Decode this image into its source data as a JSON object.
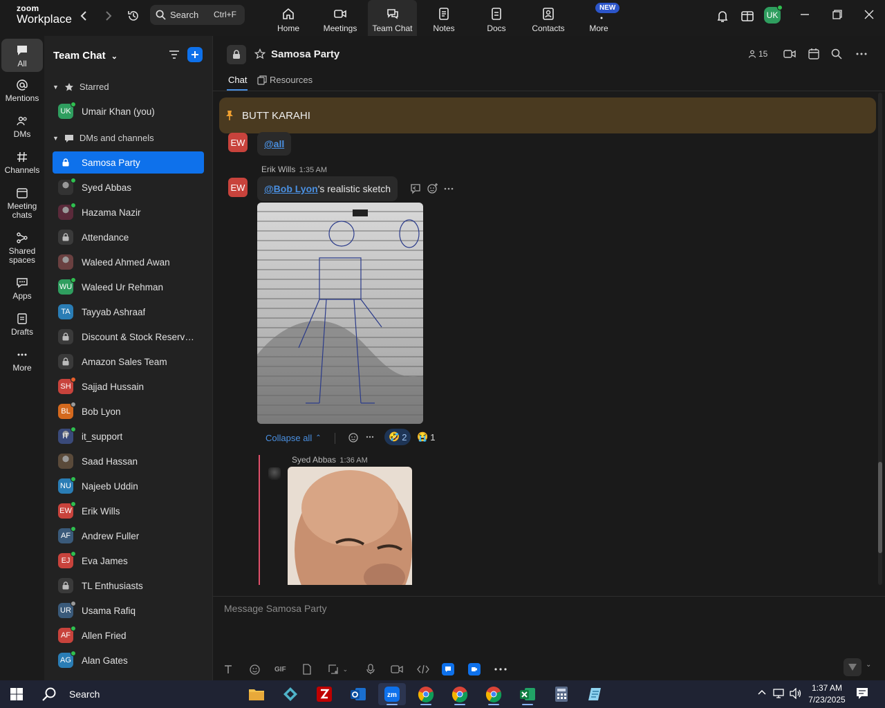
{
  "app": {
    "logo_top": "zoom",
    "logo_bottom": "Workplace"
  },
  "search": {
    "label": "Search",
    "shortcut": "Ctrl+F"
  },
  "top_tabs": [
    {
      "label": "Home",
      "icon": "home-icon"
    },
    {
      "label": "Meetings",
      "icon": "video-icon"
    },
    {
      "label": "Team Chat",
      "icon": "chat-icon",
      "active": true
    },
    {
      "label": "Notes",
      "icon": "notes-icon"
    },
    {
      "label": "Docs",
      "icon": "docs-icon"
    },
    {
      "label": "Contacts",
      "icon": "contacts-icon"
    },
    {
      "label": "More",
      "icon": "more-icon"
    }
  ],
  "new_badge": "NEW",
  "user_avatar": "UK",
  "rail": [
    {
      "label": "All",
      "icon": "chat-bubble-icon",
      "active": true
    },
    {
      "label": "Mentions",
      "icon": "at-icon"
    },
    {
      "label": "DMs",
      "icon": "people-icon"
    },
    {
      "label": "Channels",
      "icon": "hash-icon"
    },
    {
      "label": "Meeting chats",
      "icon": "calendar-icon"
    },
    {
      "label": "Shared spaces",
      "icon": "share-icon"
    },
    {
      "label": "Apps",
      "icon": "apps-icon"
    },
    {
      "label": "Drafts",
      "icon": "drafts-icon"
    },
    {
      "label": "More",
      "icon": "more-icon"
    }
  ],
  "sidebar": {
    "title": "Team Chat",
    "starred_label": "Starred",
    "dms_label": "DMs and channels",
    "starred": [
      {
        "label": "Umair Khan (you)",
        "initials": "UK",
        "color": "#2f9e5f",
        "status": "online"
      }
    ],
    "items": [
      {
        "label": "Samosa Party",
        "type": "lock",
        "selected": true
      },
      {
        "label": "Syed Abbas",
        "initials": "",
        "color": "#333",
        "type": "photo",
        "status": "online"
      },
      {
        "label": "Hazama Nazir",
        "initials": "",
        "color": "#5a2a3a",
        "type": "photo",
        "status": "online"
      },
      {
        "label": "Attendance",
        "type": "lock"
      },
      {
        "label": "Waleed Ahmed Awan",
        "initials": "",
        "color": "#6a4040",
        "type": "photo"
      },
      {
        "label": "Waleed Ur Rehman",
        "initials": "WU",
        "color": "#2f9e5f",
        "status": "online"
      },
      {
        "label": "Tayyab Ashraaf",
        "initials": "TA",
        "color": "#2a7db5"
      },
      {
        "label": "Discount & Stock Reservati...",
        "type": "lock"
      },
      {
        "label": "Amazon Sales Team",
        "type": "lock"
      },
      {
        "label": "Sajjad Hussain",
        "initials": "SH",
        "color": "#c8433c",
        "status": "busy"
      },
      {
        "label": "Bob Lyon",
        "initials": "BL",
        "color": "#d4691e",
        "status": "away"
      },
      {
        "label": "it_support",
        "initials": "IT",
        "color": "#3a4a7a",
        "type": "photo",
        "status": "online"
      },
      {
        "label": "Saad Hassan",
        "initials": "",
        "color": "#5a4a3a",
        "type": "photo"
      },
      {
        "label": "Najeeb Uddin",
        "initials": "NU",
        "color": "#2a7db5",
        "status": "online"
      },
      {
        "label": "Erik Wills",
        "initials": "EW",
        "color": "#c8433c",
        "status": "online"
      },
      {
        "label": "Andrew Fuller",
        "initials": "AF",
        "color": "#3a5a7a",
        "status": "online"
      },
      {
        "label": "Eva James",
        "initials": "EJ",
        "color": "#c8433c",
        "status": "online"
      },
      {
        "label": "TL Enthusiasts",
        "type": "lock"
      },
      {
        "label": "Usama Rafiq",
        "initials": "UR",
        "color": "#3a5a7a",
        "status": "away"
      },
      {
        "label": "Allen Fried",
        "initials": "AF",
        "color": "#c8433c",
        "status": "online"
      },
      {
        "label": "Alan Gates",
        "initials": "AG",
        "color": "#2a7db5",
        "status": "online"
      }
    ]
  },
  "channel": {
    "name": "Samosa Party",
    "member_count": "15",
    "tabs": [
      {
        "label": "Chat",
        "active": true
      },
      {
        "label": "Resources"
      }
    ],
    "pinned": "BUTT KARAHI"
  },
  "messages": {
    "first_avatar": "EW",
    "first_text": "@all",
    "second_author": "Erik Wills",
    "second_time": "1:35 AM",
    "second_avatar": "EW",
    "second_mention": "@Bob Lyon",
    "second_text": "'s realistic sketch",
    "collapse_label": "Collapse all",
    "reactions": [
      {
        "emoji": "🤣",
        "count": "2"
      },
      {
        "emoji": "😭",
        "count": "1"
      }
    ],
    "reply_author": "Syed Abbas",
    "reply_time": "1:36 AM"
  },
  "composer": {
    "placeholder": "Message Samosa Party",
    "gif_label": "GIF"
  },
  "taskbar": {
    "search_label": "Search",
    "time": "1:37 AM",
    "date": "7/23/2025"
  }
}
